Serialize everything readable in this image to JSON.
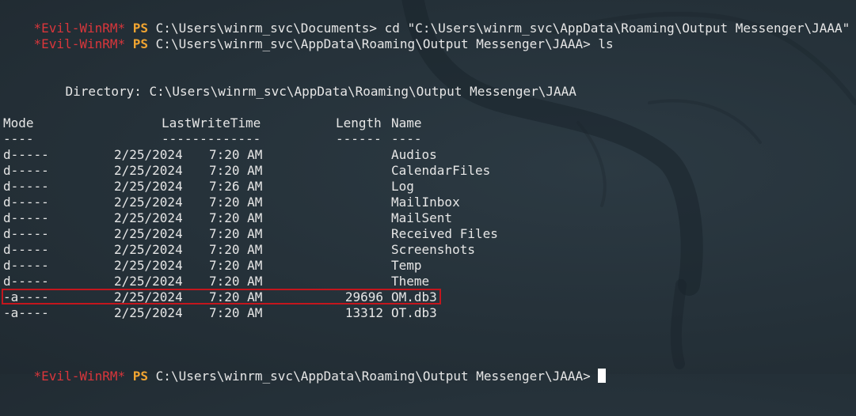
{
  "prompt": {
    "name": "*Evil-WinRM*",
    "ps": "PS"
  },
  "commands": [
    {
      "path": "C:\\Users\\winrm_svc\\Documents>",
      "command": "cd \"C:\\Users\\winrm_svc\\AppData\\Roaming\\Output Messenger\\JAAA\""
    },
    {
      "path": "C:\\Users\\winrm_svc\\AppData\\Roaming\\Output Messenger\\JAAA>",
      "command": "ls"
    },
    {
      "path": "C:\\Users\\winrm_svc\\AppData\\Roaming\\Output Messenger\\JAAA>",
      "command": ""
    }
  ],
  "directory": {
    "label": "Directory:",
    "path": "C:\\Users\\winrm_svc\\AppData\\Roaming\\Output Messenger\\JAAA"
  },
  "listing": {
    "headers": {
      "mode": "Mode",
      "lastwritetime": "LastWriteTime",
      "length": "Length",
      "name": "Name"
    },
    "underlines": {
      "mode": "----",
      "lastwritetime": "-------------",
      "length": "------",
      "name": "----"
    },
    "rows": [
      {
        "mode": "d-----",
        "date": "2/25/2024",
        "time": "7:20 AM",
        "length": "",
        "name": "Audios"
      },
      {
        "mode": "d-----",
        "date": "2/25/2024",
        "time": "7:20 AM",
        "length": "",
        "name": "CalendarFiles"
      },
      {
        "mode": "d-----",
        "date": "2/25/2024",
        "time": "7:26 AM",
        "length": "",
        "name": "Log"
      },
      {
        "mode": "d-----",
        "date": "2/25/2024",
        "time": "7:20 AM",
        "length": "",
        "name": "MailInbox"
      },
      {
        "mode": "d-----",
        "date": "2/25/2024",
        "time": "7:20 AM",
        "length": "",
        "name": "MailSent"
      },
      {
        "mode": "d-----",
        "date": "2/25/2024",
        "time": "7:20 AM",
        "length": "",
        "name": "Received Files"
      },
      {
        "mode": "d-----",
        "date": "2/25/2024",
        "time": "7:20 AM",
        "length": "",
        "name": "Screenshots"
      },
      {
        "mode": "d-----",
        "date": "2/25/2024",
        "time": "7:20 AM",
        "length": "",
        "name": "Temp"
      },
      {
        "mode": "d-----",
        "date": "2/25/2024",
        "time": "7:20 AM",
        "length": "",
        "name": "Theme"
      },
      {
        "mode": "-a----",
        "date": "2/25/2024",
        "time": "7:20 AM",
        "length": "29696",
        "name": "OM.db3"
      },
      {
        "mode": "-a----",
        "date": "2/25/2024",
        "time": "7:20 AM",
        "length": "13312",
        "name": "OT.db3"
      }
    ]
  },
  "colors": {
    "background": "#243039",
    "prompt_name": "#d9363b",
    "prompt_ps": "#f2a531",
    "text": "#e6e6e6",
    "highlight": "#c4161d"
  },
  "icons": {
    "background": "kali-dragon-watermark",
    "cursor": "block-cursor"
  }
}
